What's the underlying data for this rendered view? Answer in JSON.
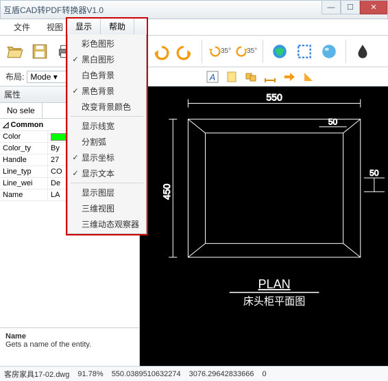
{
  "app_title": "互盾CAD转PDF转换器V1.0",
  "menus": {
    "file": "文件",
    "view": "视图",
    "display": "显示",
    "help": "帮助"
  },
  "layout": {
    "label": "布局:",
    "value": "Mode"
  },
  "dropdown": {
    "items": [
      {
        "label": "彩色图形",
        "checked": false
      },
      {
        "label": "黑白图形",
        "checked": true
      },
      {
        "label": "白色背景",
        "checked": false
      },
      {
        "label": "黑色背景",
        "checked": true
      },
      {
        "label": "改变背景颜色",
        "checked": false
      }
    ],
    "items2": [
      {
        "label": "显示线宽",
        "checked": false
      },
      {
        "label": "分割弧",
        "checked": false
      },
      {
        "label": "显示坐标",
        "checked": true
      },
      {
        "label": "显示文本",
        "checked": true
      }
    ],
    "items3": [
      {
        "label": "显示图层",
        "checked": false
      },
      {
        "label": "三维视图",
        "checked": false
      },
      {
        "label": "三维动态观察器",
        "checked": false
      }
    ]
  },
  "property": {
    "panel_title": "属性",
    "tab_active": "No sele",
    "common_hdr": "Common",
    "rows": [
      {
        "k": "Color",
        "v": ""
      },
      {
        "k": "Color_ty",
        "v": "By"
      },
      {
        "k": "Handle",
        "v": "27"
      },
      {
        "k": "Line_typ",
        "v": "CO"
      },
      {
        "k": "Line_wei",
        "v": "De"
      },
      {
        "k": "Name",
        "v": "LA"
      }
    ]
  },
  "name_panel": {
    "title": "Name",
    "desc": "Gets a name of the entity."
  },
  "canvas": {
    "dim_top": "550",
    "dim_inner_top": "50",
    "dim_left": "450",
    "dim_right": "50",
    "plan_label": "PLAN",
    "plan_sub": "床头柜平面图"
  },
  "toolbar": {
    "angle_l": "35°",
    "angle_r": "35°"
  },
  "status": {
    "file": "客房家具17-02.dwg",
    "zoom": "91.78%",
    "coord1": "550.0389510632274",
    "coord2": "3076.29642833666",
    "coord3": "0"
  }
}
